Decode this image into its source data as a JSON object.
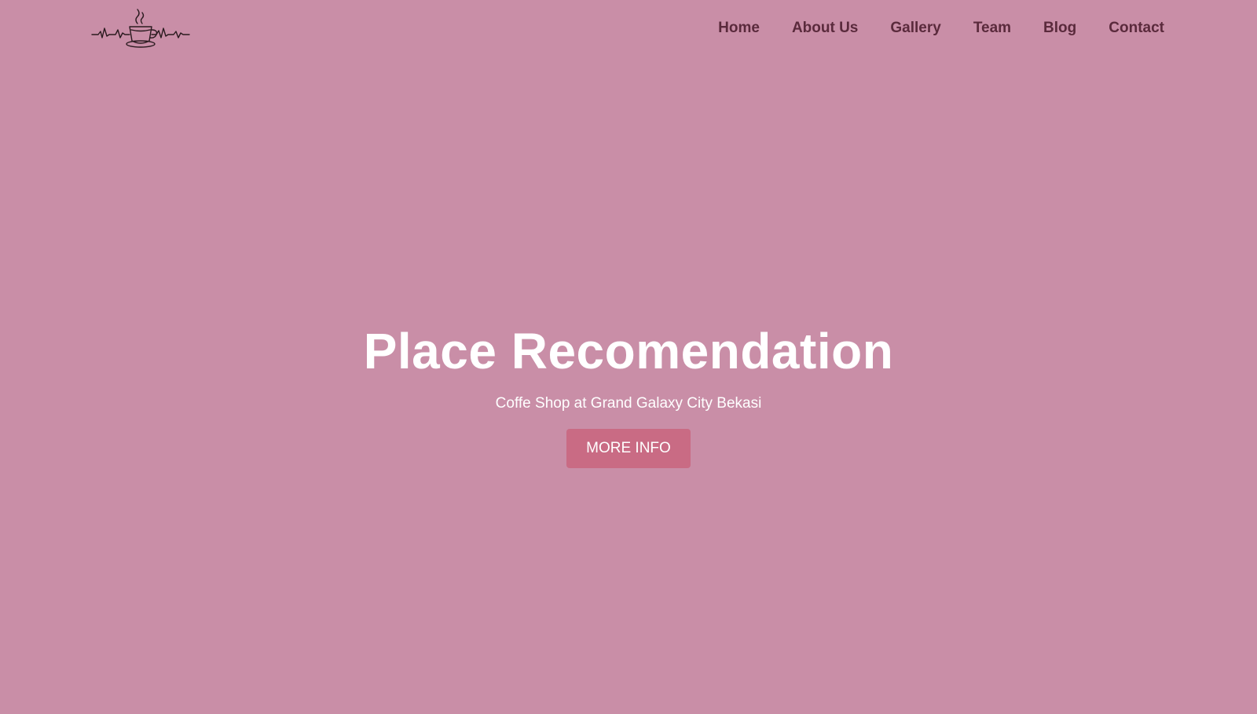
{
  "logo": {
    "icon": "coffee-cup-heartbeat-icon"
  },
  "nav": {
    "items": [
      {
        "label": "Home"
      },
      {
        "label": "About Us"
      },
      {
        "label": "Gallery"
      },
      {
        "label": "Team"
      },
      {
        "label": "Blog"
      },
      {
        "label": "Contact"
      }
    ]
  },
  "hero": {
    "title": "Place Recomendation",
    "subtitle": "Coffe Shop at Grand Galaxy City Bekasi",
    "button_label": "MORE INFO"
  },
  "colors": {
    "background": "#c98ea7",
    "nav_text": "#5a2a3c",
    "button": "#c96b84",
    "hero_text": "#ffffff"
  }
}
